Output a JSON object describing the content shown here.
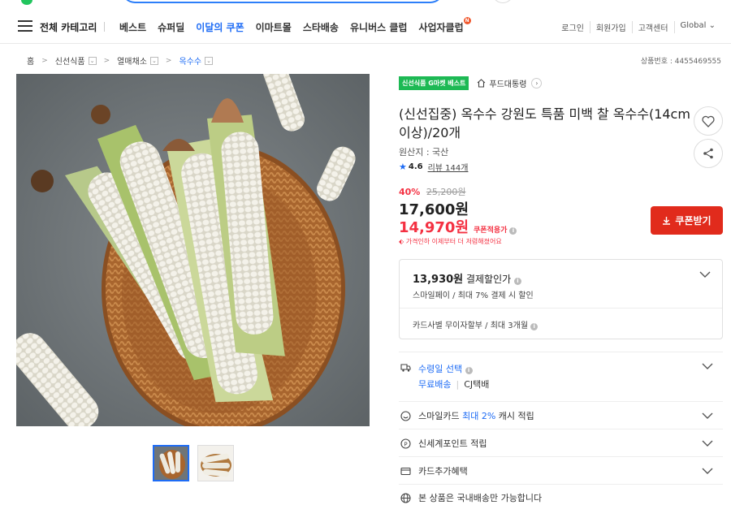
{
  "nav": {
    "category_label": "전체 카테고리",
    "links": [
      {
        "label": "베스트",
        "active": false
      },
      {
        "label": "슈퍼딜",
        "active": false
      },
      {
        "label": "이달의 쿠폰",
        "active": true
      },
      {
        "label": "이마트몰",
        "active": false
      },
      {
        "label": "스타배송",
        "active": false
      },
      {
        "label": "유니버스 클럽",
        "active": false
      },
      {
        "label": "사업자클럽",
        "active": false,
        "new_badge": "N"
      }
    ],
    "util": [
      "로그인",
      "회원가입",
      "고객센터",
      "Global ⌄"
    ]
  },
  "breadcrumb": {
    "home": "홈",
    "items": [
      "신선식품",
      "열매채소",
      "옥수수"
    ],
    "product_no": "상품번호 : 4455469555"
  },
  "product": {
    "badge": "신선식품 G마켓 베스트",
    "store": "푸드대통령",
    "title": "(신선집중) 옥수수 강원도 특품 미백 찰 옥수수(14cm 이상)/20개",
    "origin": "원산지 : 국산",
    "rating": "4.6",
    "review": "리뷰 144개",
    "discount_rate": "40%",
    "original_price": "25,200원",
    "sale_price": "17,600원",
    "coupon_price": "14,970원",
    "coupon_tag": "쿠폰적용가",
    "price_alert": "가격인하 이제부터 더 저렴해졌어요",
    "coupon_button": "쿠폰받기"
  },
  "payment": {
    "amount": "13,930원",
    "amount_suffix": " 결제할인가",
    "desc": "스마일페이 / 최대 7% 결제 시 할인",
    "installment": "카드사별 무이자할부 / 최대 3개월"
  },
  "delivery": {
    "title": "수령일 선택",
    "free_shipping": "무료배송",
    "carrier": "CJ택배"
  },
  "benefits": {
    "smilecard_prefix": "스마일카드 ",
    "smilecard_highlight": "최대 2%",
    "smilecard_suffix": " 캐시 적립",
    "shinsegae": "신세계포인트 적립",
    "card_extra": "카드추가혜택",
    "domestic": "본 상품은 국내배송만 가능합니다"
  },
  "colors": {
    "accent_blue": "#1e6cf5",
    "sale_red": "#f43142",
    "coupon_button": "#e12b1c",
    "badge_green": "#1db954"
  },
  "icons": [
    "menu-icon",
    "heart-icon",
    "share-icon",
    "home-icon",
    "truck-icon",
    "smile-icon",
    "p-point-icon",
    "card-icon",
    "globe-icon",
    "chevron-down-icon",
    "info-icon",
    "download-icon"
  ]
}
